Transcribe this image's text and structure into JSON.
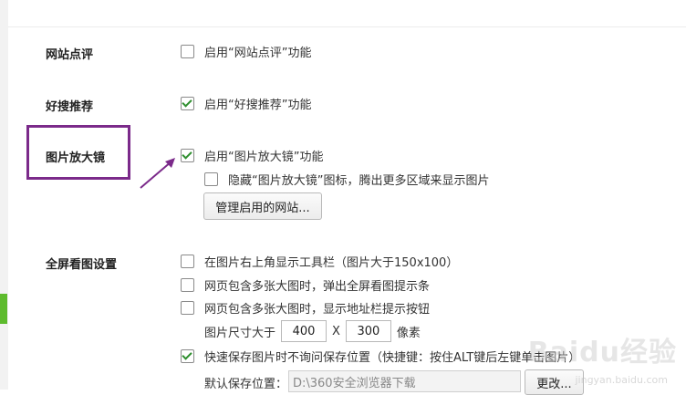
{
  "sections": {
    "site_review": {
      "title": "网站点评",
      "option": {
        "label": "启用“网站点评”功能",
        "checked": false
      }
    },
    "good_search": {
      "title": "好搜推荐",
      "option": {
        "label": "启用“好搜推荐”功能",
        "checked": true
      }
    },
    "magnifier": {
      "title": "图片放大镜",
      "enable": {
        "label": "启用“图片放大镜”功能",
        "checked": true
      },
      "hide_icon": {
        "label": "隐藏“图片放大镜”图标，腾出更多区域来显示图片",
        "checked": false
      },
      "manage_button": "管理启用的网站..."
    },
    "fullscreen": {
      "title": "全屏看图设置",
      "toolbar": {
        "label": "在图片右上角显示工具栏（图片大于150x100）",
        "checked": false
      },
      "popup": {
        "label": "网页包含多张大图时，弹出全屏看图提示条",
        "checked": false
      },
      "addressbar": {
        "label": "网页包含多张大图时，显示地址栏提示按钮",
        "checked": false
      },
      "size": {
        "label": "图片尺寸大于",
        "width": "400",
        "sep": "X",
        "height": "300",
        "unit": "像素"
      },
      "quick_save": {
        "label": "快速保存图片时不询问保存位置（快捷键：按住ALT键后左键单击图片）",
        "checked": true
      },
      "save_path": {
        "label": "默认保存位置：",
        "value": "D:\\360安全浏览器下载",
        "change_button": "更改..."
      }
    }
  },
  "watermark": {
    "brand": "Baidu经验",
    "url": "jingyan.baidu.com"
  },
  "colors": {
    "accent_green": "#5dbb2d",
    "highlight_purple": "#7b2a8a",
    "check_green": "#2f8f2f"
  }
}
